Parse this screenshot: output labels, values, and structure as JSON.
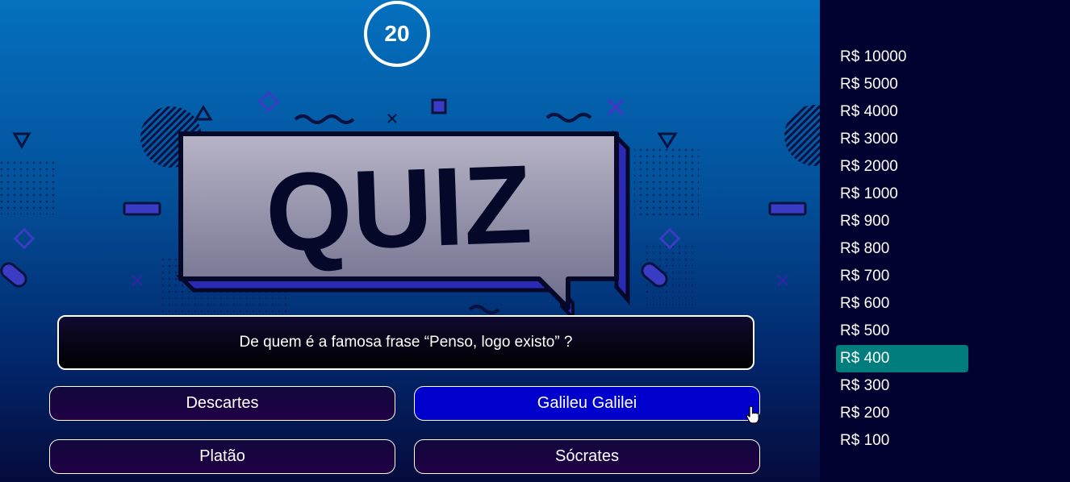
{
  "timer": {
    "value": "20"
  },
  "banner": {
    "text": "QUIZ"
  },
  "question": {
    "text": "De quem é a famosa frase “Penso, logo existo” ?"
  },
  "answers": [
    {
      "label": "Descartes"
    },
    {
      "label": "Galileu Galilei"
    },
    {
      "label": "Platão"
    },
    {
      "label": "Sócrates"
    }
  ],
  "prizes": [
    "R$ 10000",
    "R$ 5000",
    "R$ 4000",
    "R$ 3000",
    "R$ 2000",
    "R$ 1000",
    "R$ 900",
    "R$ 800",
    "R$ 700",
    "R$ 600",
    "R$ 500",
    "R$ 400",
    "R$ 300",
    "R$ 200",
    "R$ 100"
  ],
  "active_prize": "R$ 400",
  "hovered_answer": "Galileu Galilei",
  "colors": {
    "active_prize_bg": "#017d7d",
    "hovered_answer_bg": "#0000cc",
    "answer_bg": "#1a0a40",
    "sidebar_bg": "#020230"
  }
}
